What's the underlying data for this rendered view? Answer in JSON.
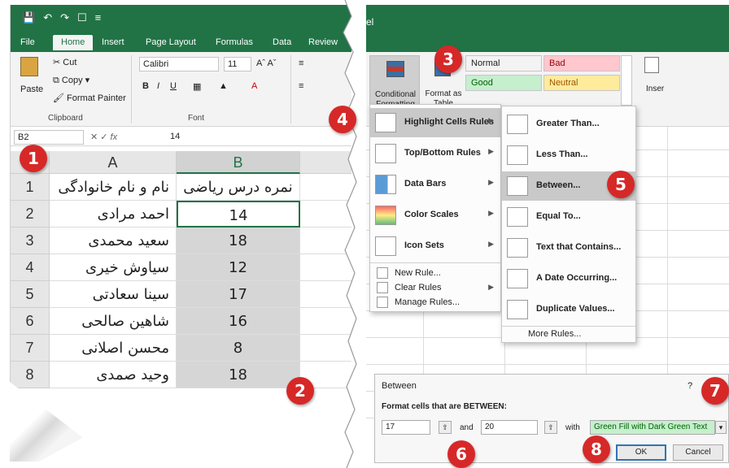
{
  "window": {
    "title": "Excel"
  },
  "ribbon": {
    "tabs": [
      "File",
      "Home",
      "Insert",
      "Page Layout",
      "Formulas",
      "Data",
      "Review"
    ],
    "clipboard": {
      "paste": "Paste",
      "cut": "Cut",
      "copy": "Copy",
      "format_painter": "Format Painter",
      "group": "Clipboard"
    },
    "font": {
      "name": "Calibri",
      "size": "11",
      "group": "Font"
    },
    "conditional_formatting": "Conditional Formatting",
    "format_as_table": "Format as Table",
    "insert": "Inser",
    "styles": [
      {
        "name": "Normal",
        "bg": "#ffffff",
        "fg": "#222222"
      },
      {
        "name": "Bad",
        "bg": "#ffc7ce",
        "fg": "#9c0006"
      },
      {
        "name": "Good",
        "bg": "#c6efce",
        "fg": "#006100"
      },
      {
        "name": "Neutral",
        "bg": "#ffeb9c",
        "fg": "#9c5700"
      }
    ]
  },
  "formula_bar": {
    "name_box": "B2",
    "fx": "fx",
    "value": "14"
  },
  "sheet": {
    "columns": [
      "A",
      "B"
    ],
    "rows": [
      "1",
      "2",
      "3",
      "4",
      "5",
      "6",
      "7",
      "8"
    ],
    "cells": [
      {
        "a": "نام و نام خانوادگی",
        "b": "نمره درس ریاضی"
      },
      {
        "a": "احمد مرادی",
        "b": "14"
      },
      {
        "a": "سعید محمدی",
        "b": "18"
      },
      {
        "a": "سیاوش خیری",
        "b": "12"
      },
      {
        "a": "سینا سعادتی",
        "b": "17"
      },
      {
        "a": "شاهین صالحی",
        "b": "16"
      },
      {
        "a": "محسن اصلانی",
        "b": "8"
      },
      {
        "a": "وحید صمدی",
        "b": "18"
      }
    ]
  },
  "cf_menu": {
    "items": [
      {
        "label": "Highlight Cells Rules",
        "icon": "highlight-cells-icon"
      },
      {
        "label": "Top/Bottom Rules",
        "icon": "top-bottom-icon"
      },
      {
        "label": "Data Bars",
        "icon": "data-bars-icon"
      },
      {
        "label": "Color Scales",
        "icon": "color-scales-icon"
      },
      {
        "label": "Icon Sets",
        "icon": "icon-sets-icon"
      }
    ],
    "small_items": [
      "New Rule...",
      "Clear Rules",
      "Manage Rules..."
    ]
  },
  "highlight_submenu": {
    "items": [
      "Greater Than...",
      "Less Than...",
      "Between...",
      "Equal To...",
      "Text that Contains...",
      "A Date Occurring...",
      "Duplicate Values..."
    ],
    "more": "More Rules..."
  },
  "dialog": {
    "title": "Between",
    "help": "?",
    "close": "✕",
    "subtitle": "Format cells that are BETWEEN:",
    "from": "17",
    "and_label": "and",
    "to": "20",
    "with_label": "with",
    "format": "Green Fill with Dark Green Text",
    "ok": "OK",
    "cancel": "Cancel"
  },
  "callouts": [
    "1",
    "2",
    "3",
    "4",
    "5",
    "6",
    "7",
    "8"
  ],
  "colors": {
    "excel_green": "#217346",
    "callout_red": "#d72828",
    "selection_gray": "#d6d6d6"
  }
}
